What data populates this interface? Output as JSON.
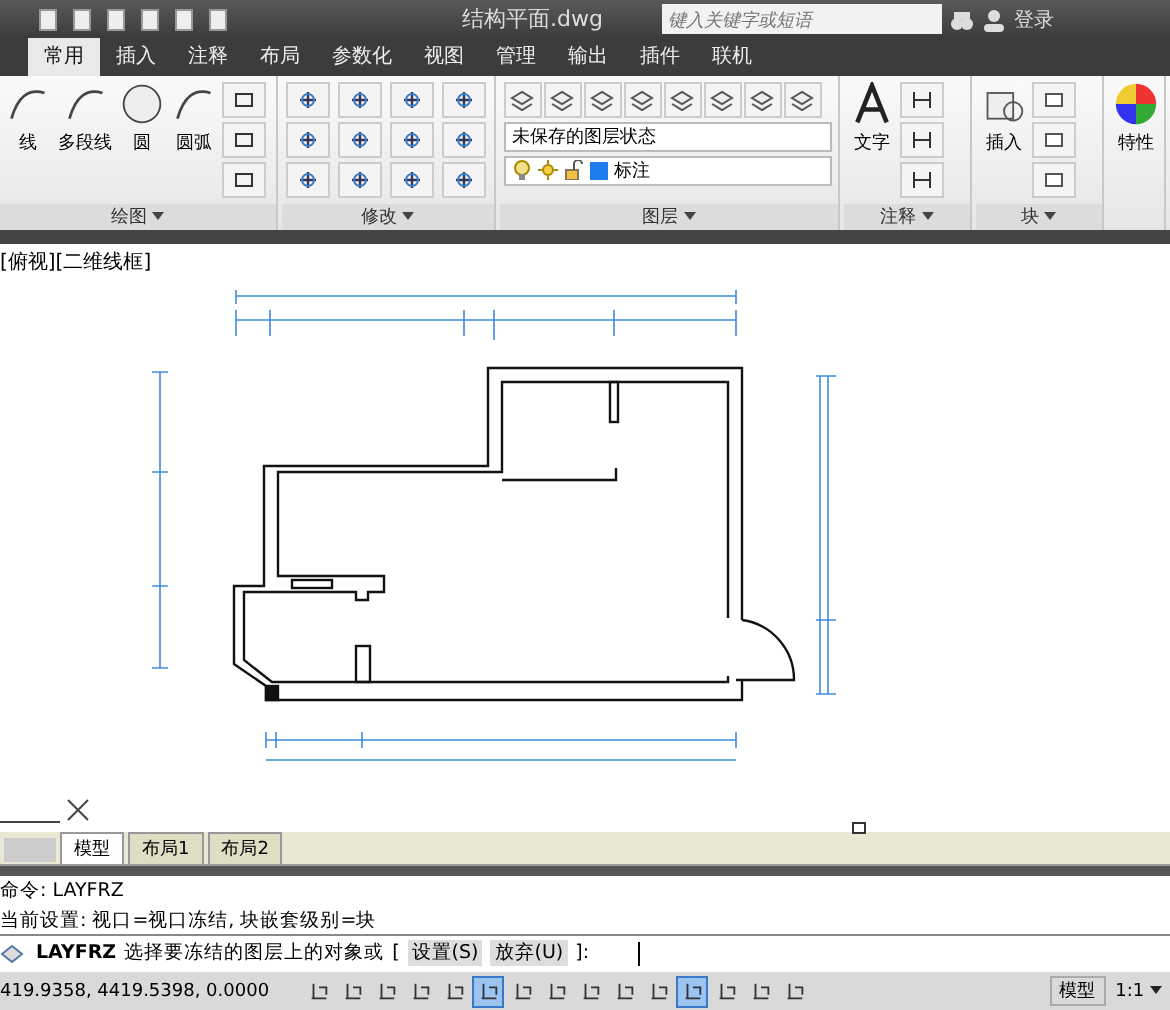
{
  "title": "结构平面.dwg",
  "search": {
    "placeholder": "键入关键字或短语"
  },
  "login": "登录",
  "ribbon_tabs": [
    {
      "label": "常用",
      "selected": true
    },
    {
      "label": "插入",
      "selected": false
    },
    {
      "label": "注释",
      "selected": false
    },
    {
      "label": "布局",
      "selected": false
    },
    {
      "label": "参数化",
      "selected": false
    },
    {
      "label": "视图",
      "selected": false
    },
    {
      "label": "管理",
      "selected": false
    },
    {
      "label": "输出",
      "selected": false
    },
    {
      "label": "插件",
      "selected": false
    },
    {
      "label": "联机",
      "selected": false
    }
  ],
  "draw_panel": {
    "title": "绘图",
    "tools": [
      "线",
      "多段线",
      "圆",
      "圆弧"
    ]
  },
  "modify_panel": {
    "title": "修改"
  },
  "layer_panel": {
    "title": "图层",
    "layer_state": "未保存的图层状态",
    "current_layer": "标注"
  },
  "annotation_panel": {
    "title": "注释",
    "tool": "文字"
  },
  "block_panel": {
    "title": "块",
    "tool": "插入"
  },
  "properties_panel": {
    "tool": "特性"
  },
  "viewport_label": "[俯视][二维线框]",
  "layout_tabs": [
    {
      "label": "模型",
      "selected": true
    },
    {
      "label": "布局1",
      "selected": false
    },
    {
      "label": "布局2",
      "selected": false
    }
  ],
  "command_history": [
    "命令: LAYFRZ",
    "当前设置: 视口=视口冻结, 块嵌套级别=块"
  ],
  "command_prompt": {
    "command": "LAYFRZ",
    "text": "选择要冻结的图层上的对象或",
    "open": "[",
    "options": [
      "设置(S)",
      "放弃(U)"
    ],
    "close": "]:"
  },
  "status_bar": {
    "coordinates": "419.9358, 4419.5398, 0.0000",
    "toggles": [
      {
        "on": false
      },
      {
        "on": false
      },
      {
        "on": false
      },
      {
        "on": false
      },
      {
        "on": false
      },
      {
        "on": true
      },
      {
        "on": false
      },
      {
        "on": false
      },
      {
        "on": false
      },
      {
        "on": false
      },
      {
        "on": false
      },
      {
        "on": true
      },
      {
        "on": false
      },
      {
        "on": false
      },
      {
        "on": false
      }
    ],
    "space": "模型",
    "scale": "1:1"
  }
}
